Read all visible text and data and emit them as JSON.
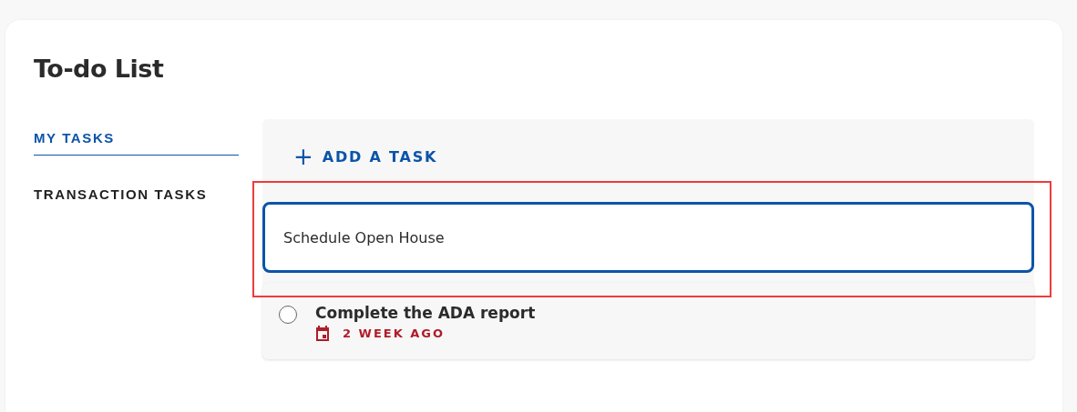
{
  "title": "To-do List",
  "tabs": [
    {
      "label": "MY TASKS",
      "selected": true
    },
    {
      "label": "TRANSACTION TASKS",
      "selected": false
    }
  ],
  "add_task": {
    "icon": "+",
    "label": "ADD A TASK"
  },
  "new_task": {
    "value": "Schedule Open House",
    "highlighted": true
  },
  "tasks": [
    {
      "title": "Complete the ADA report",
      "due": "2 WEEK AGO",
      "checked": false,
      "overdue": true
    }
  ]
}
